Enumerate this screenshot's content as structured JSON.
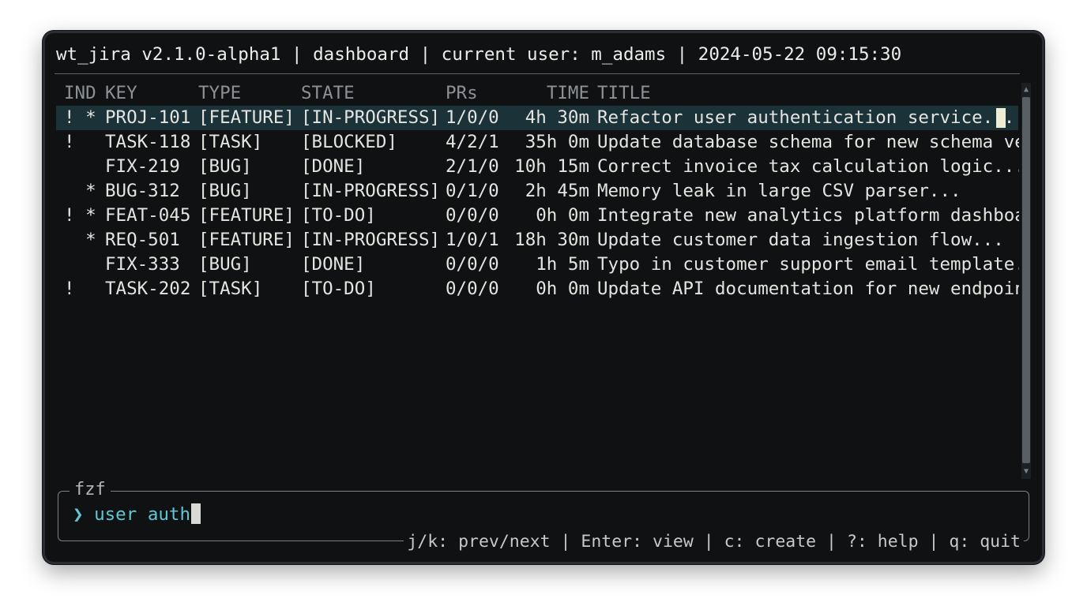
{
  "header": {
    "title": "wt_jira v2.1.0-alpha1 | dashboard | current user: m_adams | 2024-05-22 09:15:30"
  },
  "table": {
    "columns": {
      "ind": "IND",
      "key": "KEY",
      "type": "TYPE",
      "state": "STATE",
      "prs": "PRs",
      "time": "TIME",
      "title": "TITLE"
    },
    "rows": [
      {
        "ind": "! *",
        "key": "PROJ-101",
        "type": "[FEATURE]",
        "state": "[IN-PROGRESS]",
        "prs": "1/0/0",
        "time": "4h 30m",
        "title": "Refactor user authentication service..."
      },
      {
        "ind": "!",
        "key": "TASK-118",
        "type": "[TASK]",
        "state": "[BLOCKED]",
        "prs": "4/2/1",
        "time": "35h 0m",
        "title": "Update database schema for new schema ver"
      },
      {
        "ind": "",
        "key": "FIX-219",
        "type": "[BUG]",
        "state": "[DONE]",
        "prs": "2/1/0",
        "time": "10h 15m",
        "title": "Correct invoice tax calculation logic..."
      },
      {
        "ind": "  *",
        "key": "BUG-312",
        "type": "[BUG]",
        "state": "[IN-PROGRESS]",
        "prs": "0/1/0",
        "time": "2h 45m",
        "title": "Memory leak in large CSV parser..."
      },
      {
        "ind": "! *",
        "key": "FEAT-045",
        "type": "[FEATURE]",
        "state": "[TO-DO]",
        "prs": "0/0/0",
        "time": "0h 0m",
        "title": "Integrate new analytics platform dashboar"
      },
      {
        "ind": "  *",
        "key": "REQ-501",
        "type": "[FEATURE]",
        "state": "[IN-PROGRESS]",
        "prs": "1/0/1",
        "time": "18h 30m",
        "title": "Update customer data ingestion flow..."
      },
      {
        "ind": "",
        "key": "FIX-333",
        "type": "[BUG]",
        "state": "[DONE]",
        "prs": "0/0/0",
        "time": "1h 5m",
        "title": "Typo in customer support email template.."
      },
      {
        "ind": "!",
        "key": "TASK-202",
        "type": "[TASK]",
        "state": "[TO-DO]",
        "prs": "0/0/0",
        "time": "0h 0m",
        "title": "Update API documentation for new endpoint"
      }
    ],
    "selected_index": 0
  },
  "scrollbar": {
    "up_arrow": "▲",
    "down_arrow": "▼"
  },
  "fzf": {
    "label": "fzf",
    "prompt_symbol": "❯",
    "query": "user auth",
    "help": "j/k: prev/next | Enter: view | c: create | ?: help | q: quit"
  },
  "colors": {
    "background": "#0f1113",
    "selected_row": "#1b3238",
    "prompt": "#5ec8d4",
    "text": "#e4e4e0"
  }
}
